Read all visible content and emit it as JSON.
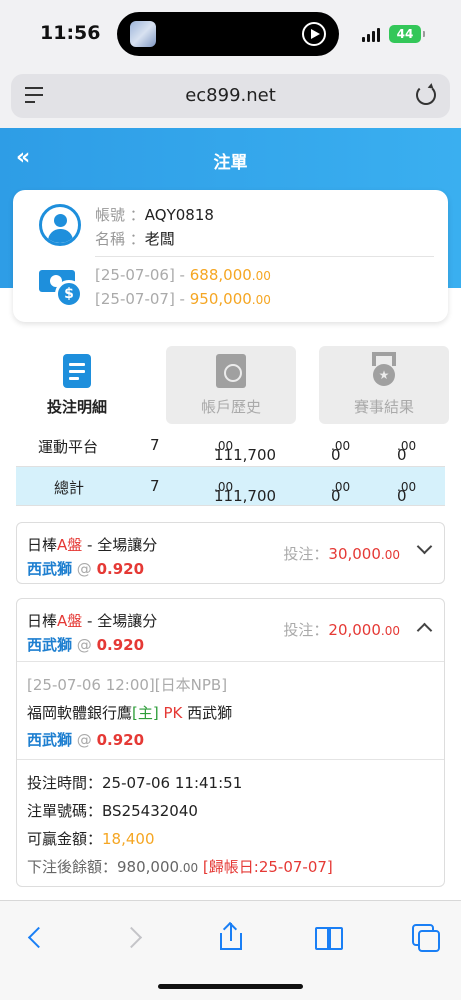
{
  "status_bar": {
    "time": "11:56",
    "battery": "44"
  },
  "browser": {
    "url": "ec899.net"
  },
  "header": {
    "title": "注單"
  },
  "account": {
    "id_label": "帳號 ：",
    "id_value": "AQY0818",
    "name_label": "名稱 ：",
    "name_value": "老闆",
    "balances": [
      {
        "date": "[25-07-06] - ",
        "amount_main": "688,000",
        "amount_dec": ".00"
      },
      {
        "date": "[25-07-07] - ",
        "amount_main": "950,000",
        "amount_dec": ".00"
      }
    ]
  },
  "tabs": [
    {
      "label": "投注明細",
      "icon": "receipt-icon",
      "active": true
    },
    {
      "label": "帳戶歷史",
      "icon": "history-icon",
      "active": false
    },
    {
      "label": "賽事結果",
      "icon": "medal-icon",
      "active": false
    }
  ],
  "summary": {
    "rows": [
      {
        "name": "運動平台",
        "count": "7",
        "amount_main": "111,700",
        "amount_dec": ".00",
        "col4_main": "0",
        "col4_dec": ".00",
        "col5_main": "0",
        "col5_dec": ".00"
      }
    ],
    "total": {
      "name": "總計",
      "count": "7",
      "amount_main": "111,700",
      "amount_dec": ".00",
      "col4_main": "0",
      "col4_dec": ".00",
      "col5_main": "0",
      "col5_dec": ".00"
    }
  },
  "bets": [
    {
      "sport": "日棒",
      "market_tag": "A盤",
      "market": " - 全場讓分",
      "pick": "西武獅",
      "at": " @ ",
      "odds": "0.920",
      "stake_label": "投注：",
      "stake_main": "30,000",
      "stake_dec": ".00",
      "expanded": false
    },
    {
      "sport": "日棒",
      "market_tag": "A盤",
      "market": " - 全場讓分",
      "pick": "西武獅",
      "at": " @ ",
      "odds": "0.920",
      "stake_label": "投注：",
      "stake_main": "20,000",
      "stake_dec": ".00",
      "expanded": true,
      "detail": {
        "event_info": "[25-07-06 12:00][日本NPB]",
        "home": "福岡軟體銀行鷹",
        "home_tag": "[主]",
        "vs": " PK ",
        "away": "西武獅",
        "pick": "西武獅",
        "at": " @ ",
        "odds": "0.920",
        "bet_time_label": "投注時間：",
        "bet_time": "25-07-06 11:41:51",
        "ticket_label": "注單號碼：",
        "ticket": "BS25432040",
        "win_label": "可贏金額：",
        "win": "18,400",
        "balance_label": "下注後餘額：",
        "balance_main": "980,000",
        "balance_dec": ".00",
        "settle": " [歸帳日:25-07-07]"
      }
    }
  ]
}
